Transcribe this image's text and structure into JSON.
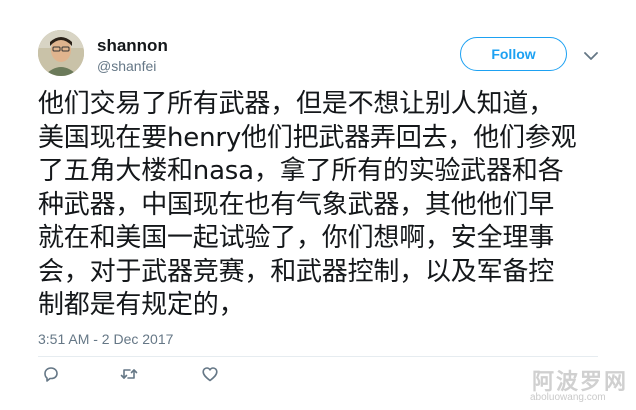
{
  "user": {
    "display_name": "shannon",
    "handle": "@shanfei",
    "avatar_icon": "user-avatar-photo"
  },
  "follow_button": {
    "label": "Follow",
    "color": "#1da1f2"
  },
  "menu": {
    "icon": "chevron-down-icon"
  },
  "tweet": {
    "text": "他们交易了所有武器，但是不想让别人知道，\n美国现在要henry他们把武器弄回去，他们参观\n了五角大楼和nasa，拿了所有的实验武器和各\n种武器，中国现在也有气象武器，其他他们早\n就在和美国一起试验了，你们想啊，安全理事\n会，对于武器竞赛，和武器控制，以及军备控\n制都是有规定的，",
    "timestamp": "3:51 AM - 2 Dec 2017"
  },
  "actions": {
    "reply_icon": "reply-icon",
    "retweet_icon": "retweet-icon",
    "like_icon": "heart-icon"
  },
  "watermark": {
    "main": "阿波罗网",
    "sub": "aboluowang.com"
  }
}
